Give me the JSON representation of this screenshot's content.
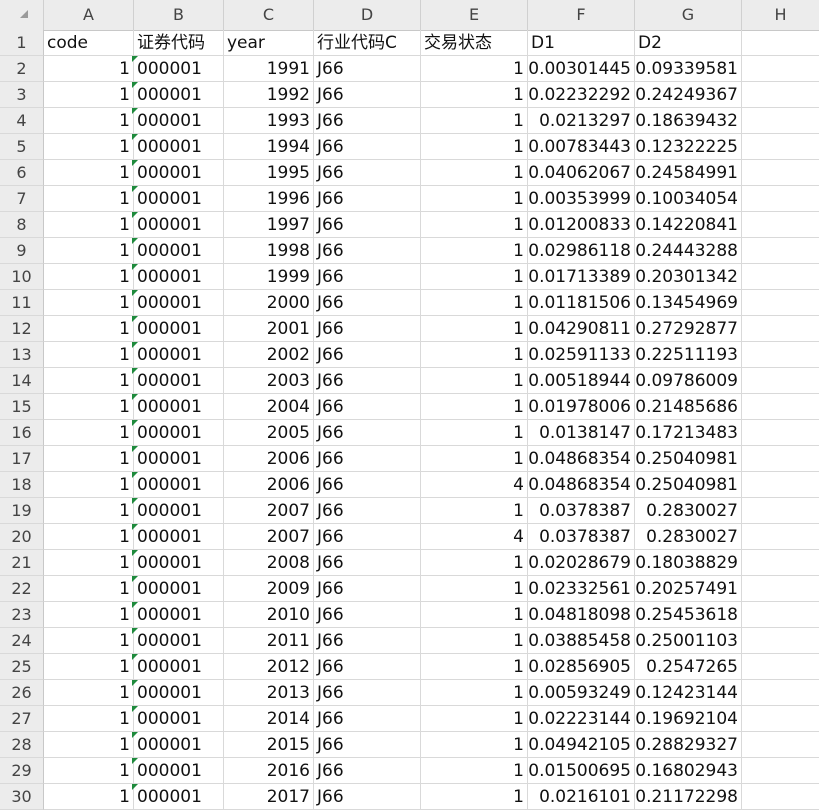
{
  "columns": [
    "A",
    "B",
    "C",
    "D",
    "E",
    "F",
    "G",
    "H"
  ],
  "rows": [
    {
      "n": "1",
      "a": "code",
      "b": "证券代码",
      "c": "year",
      "d": "行业代码C",
      "e": "交易状态",
      "f": "D1",
      "g": "D2"
    },
    {
      "n": "2",
      "a": "1",
      "b": "000001",
      "c": "1991",
      "d": "J66",
      "e": "1",
      "f": "0.00301445",
      "g": "0.09339581"
    },
    {
      "n": "3",
      "a": "1",
      "b": "000001",
      "c": "1992",
      "d": "J66",
      "e": "1",
      "f": "0.02232292",
      "g": "0.24249367"
    },
    {
      "n": "4",
      "a": "1",
      "b": "000001",
      "c": "1993",
      "d": "J66",
      "e": "1",
      "f": "0.0213297",
      "g": "0.18639432"
    },
    {
      "n": "5",
      "a": "1",
      "b": "000001",
      "c": "1994",
      "d": "J66",
      "e": "1",
      "f": "0.00783443",
      "g": "0.12322225"
    },
    {
      "n": "6",
      "a": "1",
      "b": "000001",
      "c": "1995",
      "d": "J66",
      "e": "1",
      "f": "0.04062067",
      "g": "0.24584991"
    },
    {
      "n": "7",
      "a": "1",
      "b": "000001",
      "c": "1996",
      "d": "J66",
      "e": "1",
      "f": "0.00353999",
      "g": "0.10034054"
    },
    {
      "n": "8",
      "a": "1",
      "b": "000001",
      "c": "1997",
      "d": "J66",
      "e": "1",
      "f": "0.01200833",
      "g": "0.14220841"
    },
    {
      "n": "9",
      "a": "1",
      "b": "000001",
      "c": "1998",
      "d": "J66",
      "e": "1",
      "f": "0.02986118",
      "g": "0.24443288"
    },
    {
      "n": "10",
      "a": "1",
      "b": "000001",
      "c": "1999",
      "d": "J66",
      "e": "1",
      "f": "0.01713389",
      "g": "0.20301342"
    },
    {
      "n": "11",
      "a": "1",
      "b": "000001",
      "c": "2000",
      "d": "J66",
      "e": "1",
      "f": "0.01181506",
      "g": "0.13454969"
    },
    {
      "n": "12",
      "a": "1",
      "b": "000001",
      "c": "2001",
      "d": "J66",
      "e": "1",
      "f": "0.04290811",
      "g": "0.27292877"
    },
    {
      "n": "13",
      "a": "1",
      "b": "000001",
      "c": "2002",
      "d": "J66",
      "e": "1",
      "f": "0.02591133",
      "g": "0.22511193"
    },
    {
      "n": "14",
      "a": "1",
      "b": "000001",
      "c": "2003",
      "d": "J66",
      "e": "1",
      "f": "0.00518944",
      "g": "0.09786009"
    },
    {
      "n": "15",
      "a": "1",
      "b": "000001",
      "c": "2004",
      "d": "J66",
      "e": "1",
      "f": "0.01978006",
      "g": "0.21485686"
    },
    {
      "n": "16",
      "a": "1",
      "b": "000001",
      "c": "2005",
      "d": "J66",
      "e": "1",
      "f": "0.0138147",
      "g": "0.17213483"
    },
    {
      "n": "17",
      "a": "1",
      "b": "000001",
      "c": "2006",
      "d": "J66",
      "e": "1",
      "f": "0.04868354",
      "g": "0.25040981"
    },
    {
      "n": "18",
      "a": "1",
      "b": "000001",
      "c": "2006",
      "d": "J66",
      "e": "4",
      "f": "0.04868354",
      "g": "0.25040981"
    },
    {
      "n": "19",
      "a": "1",
      "b": "000001",
      "c": "2007",
      "d": "J66",
      "e": "1",
      "f": "0.0378387",
      "g": "0.2830027"
    },
    {
      "n": "20",
      "a": "1",
      "b": "000001",
      "c": "2007",
      "d": "J66",
      "e": "4",
      "f": "0.0378387",
      "g": "0.2830027"
    },
    {
      "n": "21",
      "a": "1",
      "b": "000001",
      "c": "2008",
      "d": "J66",
      "e": "1",
      "f": "0.02028679",
      "g": "0.18038829"
    },
    {
      "n": "22",
      "a": "1",
      "b": "000001",
      "c": "2009",
      "d": "J66",
      "e": "1",
      "f": "0.02332561",
      "g": "0.20257491"
    },
    {
      "n": "23",
      "a": "1",
      "b": "000001",
      "c": "2010",
      "d": "J66",
      "e": "1",
      "f": "0.04818098",
      "g": "0.25453618"
    },
    {
      "n": "24",
      "a": "1",
      "b": "000001",
      "c": "2011",
      "d": "J66",
      "e": "1",
      "f": "0.03885458",
      "g": "0.25001103"
    },
    {
      "n": "25",
      "a": "1",
      "b": "000001",
      "c": "2012",
      "d": "J66",
      "e": "1",
      "f": "0.02856905",
      "g": "0.2547265"
    },
    {
      "n": "26",
      "a": "1",
      "b": "000001",
      "c": "2013",
      "d": "J66",
      "e": "1",
      "f": "0.00593249",
      "g": "0.12423144"
    },
    {
      "n": "27",
      "a": "1",
      "b": "000001",
      "c": "2014",
      "d": "J66",
      "e": "1",
      "f": "0.02223144",
      "g": "0.19692104"
    },
    {
      "n": "28",
      "a": "1",
      "b": "000001",
      "c": "2015",
      "d": "J66",
      "e": "1",
      "f": "0.04942105",
      "g": "0.28829327"
    },
    {
      "n": "29",
      "a": "1",
      "b": "000001",
      "c": "2016",
      "d": "J66",
      "e": "1",
      "f": "0.01500695",
      "g": "0.16802943"
    },
    {
      "n": "30",
      "a": "1",
      "b": "000001",
      "c": "2017",
      "d": "J66",
      "e": "1",
      "f": "0.0216101",
      "g": "0.21172298"
    }
  ]
}
